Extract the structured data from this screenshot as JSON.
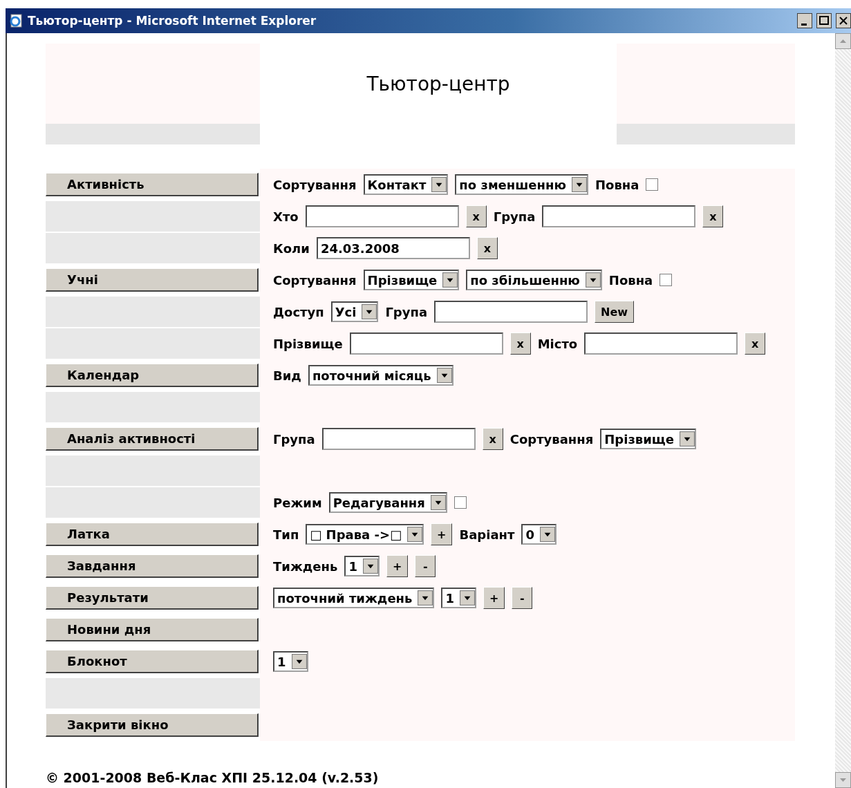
{
  "window": {
    "title": "Тьютор-центр - Microsoft Internet Explorer"
  },
  "page_title": "Тьютор-центр",
  "rows": [
    {
      "nav": {
        "kind": "button",
        "label": "Активність"
      },
      "controls": [
        {
          "kind": "label",
          "text": "Сортування"
        },
        {
          "kind": "select",
          "value": "Контакт"
        },
        {
          "kind": "select",
          "value": "по зменшенню"
        },
        {
          "kind": "label",
          "text": "Повна"
        },
        {
          "kind": "checkbox",
          "checked": false
        }
      ]
    },
    {
      "nav": {
        "kind": "blank"
      },
      "controls": [
        {
          "kind": "label",
          "text": "Хто"
        },
        {
          "kind": "field"
        },
        {
          "kind": "clear",
          "text": "x"
        },
        {
          "kind": "label",
          "text": "Група"
        },
        {
          "kind": "field"
        },
        {
          "kind": "clear",
          "text": "x"
        }
      ]
    },
    {
      "nav": {
        "kind": "blank"
      },
      "controls": [
        {
          "kind": "label",
          "text": "Коли"
        },
        {
          "kind": "field",
          "value": "24.03.2008"
        },
        {
          "kind": "clear",
          "text": "x"
        }
      ]
    },
    {
      "nav": {
        "kind": "button",
        "label": "Учні"
      },
      "controls": [
        {
          "kind": "label",
          "text": "Сортування"
        },
        {
          "kind": "select",
          "value": "Прізвище"
        },
        {
          "kind": "select",
          "value": "по збільшенню"
        },
        {
          "kind": "label",
          "text": "Повна"
        },
        {
          "kind": "checkbox",
          "checked": false
        }
      ]
    },
    {
      "nav": {
        "kind": "blank"
      },
      "controls": [
        {
          "kind": "label",
          "text": "Доступ"
        },
        {
          "kind": "select",
          "value": "Усі"
        },
        {
          "kind": "label",
          "text": "Група"
        },
        {
          "kind": "field"
        },
        {
          "kind": "button",
          "text": "New"
        }
      ]
    },
    {
      "nav": {
        "kind": "blank"
      },
      "controls": [
        {
          "kind": "label",
          "text": "Прізвище"
        },
        {
          "kind": "field"
        },
        {
          "kind": "clear",
          "text": "x"
        },
        {
          "kind": "label",
          "text": "Місто"
        },
        {
          "kind": "field"
        },
        {
          "kind": "clear",
          "text": "x"
        }
      ]
    },
    {
      "nav": {
        "kind": "button",
        "label": "Календар"
      },
      "controls": [
        {
          "kind": "label",
          "text": "Вид"
        },
        {
          "kind": "select",
          "value": "поточний місяць"
        }
      ]
    },
    {
      "nav": {
        "kind": "blank"
      },
      "controls": []
    },
    {
      "nav": {
        "kind": "button",
        "label": "Аналіз активності"
      },
      "controls": [
        {
          "kind": "label",
          "text": "Група"
        },
        {
          "kind": "field"
        },
        {
          "kind": "clear",
          "text": "x"
        },
        {
          "kind": "label",
          "text": "Сортування"
        },
        {
          "kind": "select",
          "value": "Прізвище"
        }
      ]
    },
    {
      "nav": {
        "kind": "blank"
      },
      "controls": []
    },
    {
      "nav": {
        "kind": "blank"
      },
      "controls": [
        {
          "kind": "label",
          "text": "Режим"
        },
        {
          "kind": "select",
          "value": "Редагування"
        },
        {
          "kind": "checkbox",
          "checked": false
        }
      ]
    },
    {
      "nav": {
        "kind": "button",
        "label": "Латка"
      },
      "controls": [
        {
          "kind": "label",
          "text": "Тип"
        },
        {
          "kind": "select",
          "value": "□ Права ->□"
        },
        {
          "kind": "button",
          "text": "+"
        },
        {
          "kind": "label",
          "text": "Варіант"
        },
        {
          "kind": "select",
          "value": "0"
        }
      ]
    },
    {
      "nav": {
        "kind": "button",
        "label": "Завдання"
      },
      "controls": [
        {
          "kind": "label",
          "text": "Тиждень"
        },
        {
          "kind": "select",
          "value": "1"
        },
        {
          "kind": "button",
          "text": "+"
        },
        {
          "kind": "button",
          "text": "-"
        }
      ]
    },
    {
      "nav": {
        "kind": "button",
        "label": "Результати"
      },
      "controls": [
        {
          "kind": "select",
          "value": "поточний тиждень"
        },
        {
          "kind": "select",
          "value": "1"
        },
        {
          "kind": "button",
          "text": "+"
        },
        {
          "kind": "button",
          "text": "-"
        }
      ]
    },
    {
      "nav": {
        "kind": "button",
        "label": "Новини дня"
      },
      "controls": []
    },
    {
      "nav": {
        "kind": "button",
        "label": "Блокнот"
      },
      "controls": [
        {
          "kind": "select",
          "value": "1"
        }
      ]
    },
    {
      "nav": {
        "kind": "blank"
      },
      "controls": []
    },
    {
      "nav": {
        "kind": "button",
        "label": "Закрити вікно"
      },
      "controls": []
    }
  ],
  "footer": "© 2001-2008 Веб-Клас ХПІ 25.12.04 (v.2.53)"
}
